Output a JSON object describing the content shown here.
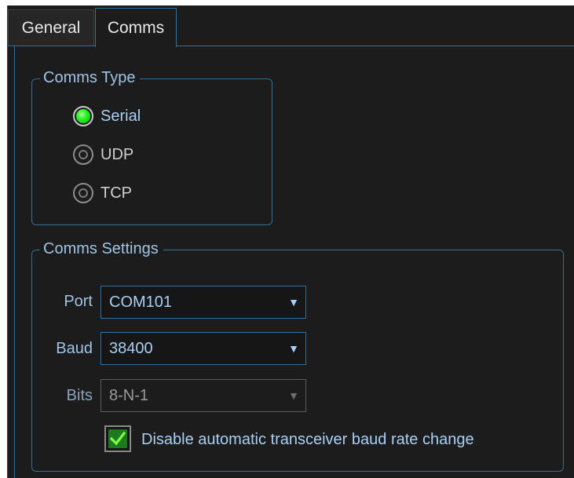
{
  "tabs": [
    {
      "label": "General",
      "selected": false
    },
    {
      "label": "Comms",
      "selected": true
    }
  ],
  "comms_type": {
    "title": "Comms Type",
    "options": [
      {
        "label": "Serial",
        "selected": true
      },
      {
        "label": "UDP",
        "selected": false
      },
      {
        "label": "TCP",
        "selected": false
      }
    ]
  },
  "comms_settings": {
    "title": "Comms Settings",
    "port": {
      "label": "Port",
      "value": "COM101",
      "enabled": true
    },
    "baud": {
      "label": "Baud",
      "value": "38400",
      "enabled": true
    },
    "bits": {
      "label": "Bits",
      "value": "8-N-1",
      "enabled": false
    },
    "disable_baud_change": {
      "label": "Disable automatic transceiver baud rate change",
      "checked": true
    }
  },
  "icons": {
    "dropdown": "chevron-down-icon",
    "check": "checkmark-icon"
  },
  "colors": {
    "accent": "#2f6f99",
    "radio_selected": "#1bf21b",
    "checkbox_fill": "#1f7a1f",
    "label_text": "#a9cff5",
    "background": "#1c1c1c"
  }
}
